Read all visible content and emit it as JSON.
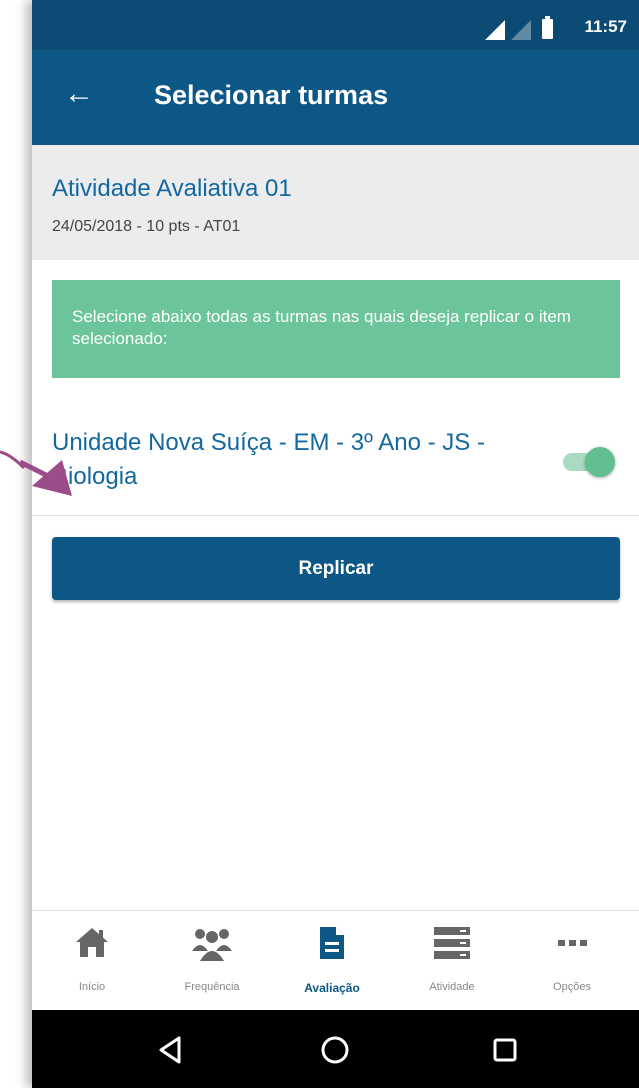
{
  "status_bar": {
    "time": "11:57"
  },
  "app_bar": {
    "back_icon": "←",
    "title": "Selecionar turmas"
  },
  "activity": {
    "title": "Atividade Avaliativa 01",
    "subtitle": "24/05/2018 - 10 pts - AT01"
  },
  "info": {
    "message": "Selecione abaixo todas as turmas nas quais deseja replicar o item selecionado:"
  },
  "class_item": {
    "label": "Unidade Nova Suíça - EM   - 3º Ano - JS - Biologia",
    "selected": true
  },
  "replicar_button": {
    "label": "Replicar"
  },
  "bottom_nav": {
    "items": [
      {
        "label": "Início",
        "icon": "home-icon"
      },
      {
        "label": "Frequência",
        "icon": "people-icon"
      },
      {
        "label": "Avaliação",
        "icon": "document-icon",
        "active": true
      },
      {
        "label": "Atividade",
        "icon": "list-icon"
      },
      {
        "label": "Opções",
        "icon": "more-icon"
      }
    ]
  },
  "colors": {
    "primary": "#0c5785",
    "status_bar": "#0b4a72",
    "success": "#6cc49b",
    "link_text": "#1468a0"
  }
}
